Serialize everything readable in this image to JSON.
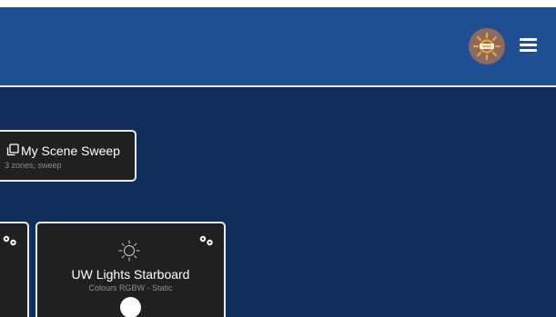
{
  "header": {
    "avatar_icon": "sun-badge-icon",
    "menu_icon": "hamburger-menu-icon",
    "accent": "#204f91"
  },
  "main": {
    "background": "#112e5a"
  },
  "scene": {
    "icon": "copy-stack-icon",
    "title": "My Scene Sweep",
    "subtitle": "3 zones, sweep"
  },
  "zones": [
    {
      "settings_icon": "gears-icon"
    },
    {
      "icon": "sun-icon",
      "settings_icon": "gears-icon",
      "title": "UW Lights Starboard",
      "subtitle": "Colours RGBW - Static",
      "toggle_state": "on"
    }
  ]
}
